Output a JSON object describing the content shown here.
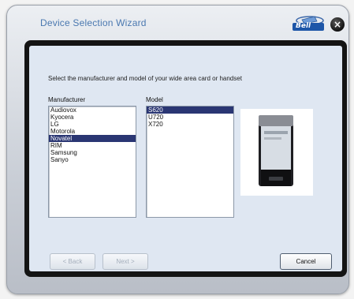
{
  "window": {
    "title": "Device Selection Wizard",
    "logo_text": "Bell",
    "close_label": "×"
  },
  "wizard": {
    "instruction": "Select the manufacturer and model of your wide area card or handset",
    "manufacturer_label": "Manufacturer",
    "model_label": "Model",
    "manufacturers": [
      {
        "label": "Audiovox",
        "selected": false
      },
      {
        "label": "Kyocera",
        "selected": false
      },
      {
        "label": "LG",
        "selected": false
      },
      {
        "label": "Motorola",
        "selected": false
      },
      {
        "label": "Novatel",
        "selected": true
      },
      {
        "label": "RIM",
        "selected": false
      },
      {
        "label": "Samsung",
        "selected": false
      },
      {
        "label": "Sanyo",
        "selected": false
      }
    ],
    "models": [
      {
        "label": "S620",
        "selected": true
      },
      {
        "label": "U720",
        "selected": false
      },
      {
        "label": "X720",
        "selected": false
      }
    ]
  },
  "buttons": {
    "back": "< Back",
    "next": "Next >",
    "cancel": "Cancel"
  },
  "colors": {
    "title": "#4a78b0",
    "selection": "#2a3673",
    "frame": "#141414",
    "content_bg": "#dfe7f2"
  }
}
